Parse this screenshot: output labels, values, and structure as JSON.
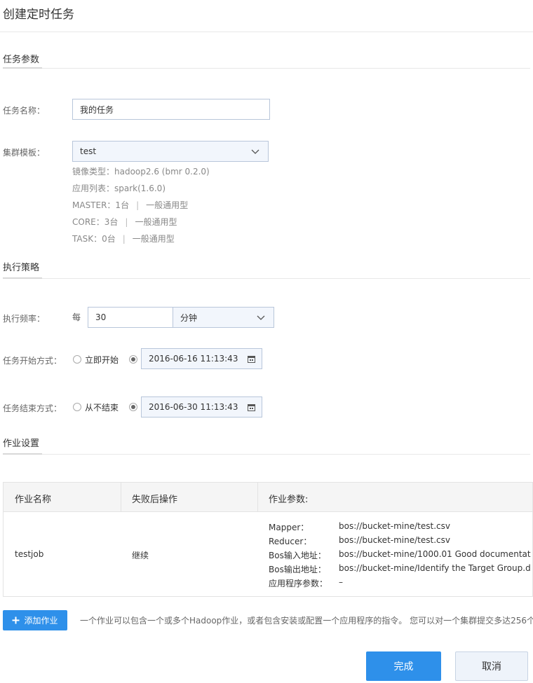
{
  "page_title": "创建定时任务",
  "sections": {
    "task_params": "任务参数",
    "exec_policy": "执行策略",
    "job_settings": "作业设置"
  },
  "task_name": {
    "label": "任务名称：",
    "value": "我的任务"
  },
  "cluster_template": {
    "label": "集群模板：",
    "value": "test",
    "info": {
      "image_type": "镜像类型：hadoop2.6 (bmr 0.2.0)",
      "app_list": "应用列表：spark(1.6.0)",
      "master": "MASTER：1台",
      "master_type": "一般通用型",
      "core": "CORE：3台",
      "core_type": "一般通用型",
      "task": "TASK：0台",
      "task_type": "一般通用型",
      "separator": "|"
    }
  },
  "frequency": {
    "label": "执行频率：",
    "prefix": "每",
    "value": "30",
    "unit": "分钟"
  },
  "start_mode": {
    "label": "任务开始方式：",
    "option_now": "立即开始",
    "datetime": "2016-06-16 11:13:43"
  },
  "end_mode": {
    "label": "任务结束方式：",
    "option_never": "从不结束",
    "datetime": "2016-06-30 11:13:43"
  },
  "jobs_table": {
    "headers": [
      "作业名称",
      "失败后操作",
      "作业参数:"
    ],
    "rows": [
      {
        "name": "testjob",
        "on_failure": "继续",
        "params": [
          {
            "key": "Mapper：",
            "value": "bos://bucket-mine/test.csv"
          },
          {
            "key": "Reducer：",
            "value": "bos://bucket-mine/test.csv"
          },
          {
            "key": "Bos输入地址：",
            "value": "bos://bucket-mine/1000.01 Good documentat"
          },
          {
            "key": "Bos输出地址：",
            "value": "bos://bucket-mine/Identify the Target Group.d"
          },
          {
            "key": "应用程序参数：",
            "value": "–"
          }
        ]
      }
    ]
  },
  "add_job_button": "添加作业",
  "add_job_hint": "一个作业可以包含一个或多个Hadoop作业，或者包含安装或配置一个应用程序的指令。 您可以对一个集群提交多达256个",
  "confirm_button": "完成",
  "cancel_button": "取消",
  "colors": {
    "primary": "#2e90ea",
    "field_border": "#b8c6da",
    "field_bg": "#f2f6fc"
  }
}
